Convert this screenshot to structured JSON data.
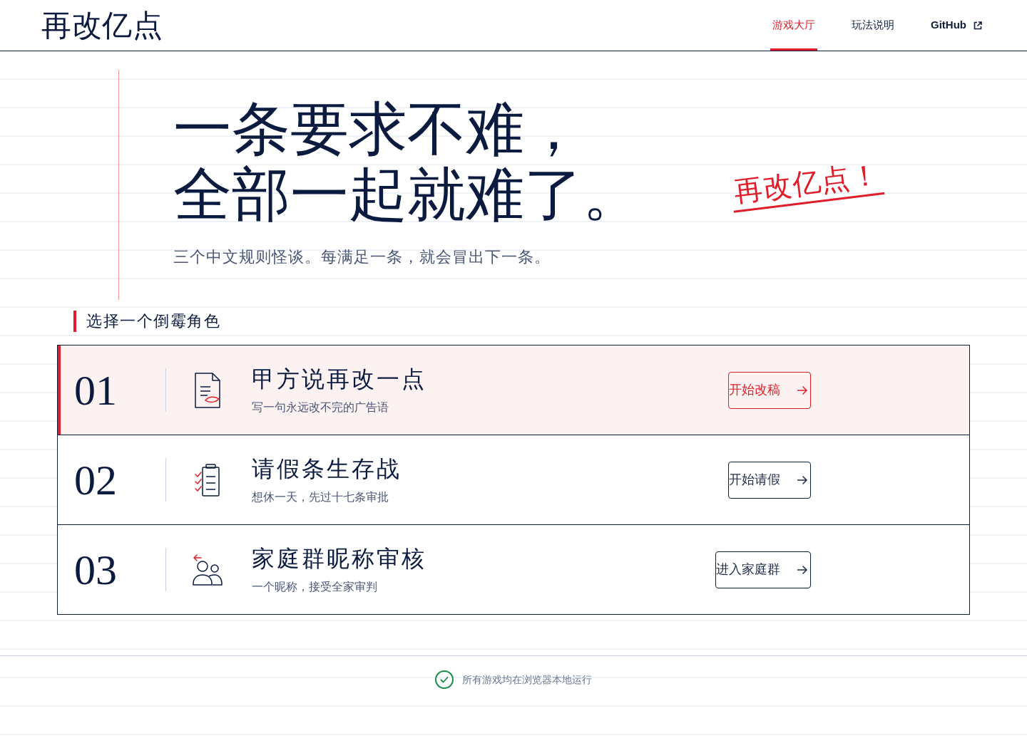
{
  "header": {
    "logo": "再改亿点",
    "nav": [
      {
        "label": "游戏大厅",
        "kind": "tab",
        "selected": true
      },
      {
        "label": "玩法说明",
        "kind": "tab",
        "selected": false
      },
      {
        "label": "GitHub",
        "kind": "external",
        "selected": false
      }
    ]
  },
  "hero": {
    "title_lines": [
      "一条要求不难，",
      "全部一起就难了。"
    ],
    "subtitle": "三个中文规则怪谈。每满足一条，就会冒出下一条。",
    "stamp": "再改亿点！"
  },
  "section_title": "选择一个倒霉角色",
  "games": [
    {
      "number": "01",
      "kind": "document",
      "title": "甲方说再改一点",
      "description": "写一句永远改不完的广告语",
      "button": "开始改稿",
      "selected": true
    },
    {
      "number": "02",
      "kind": "checklist",
      "title": "请假条生存战",
      "description": "想休一天，先过十七条审批",
      "button": "开始请假",
      "selected": false
    },
    {
      "number": "03",
      "kind": "people",
      "title": "家庭群昵称审核",
      "description": "一个昵称，接受全家审判",
      "button": "进入家庭群",
      "selected": false
    }
  ],
  "footer": {
    "note": "所有游戏均在浏览器本地运行"
  }
}
